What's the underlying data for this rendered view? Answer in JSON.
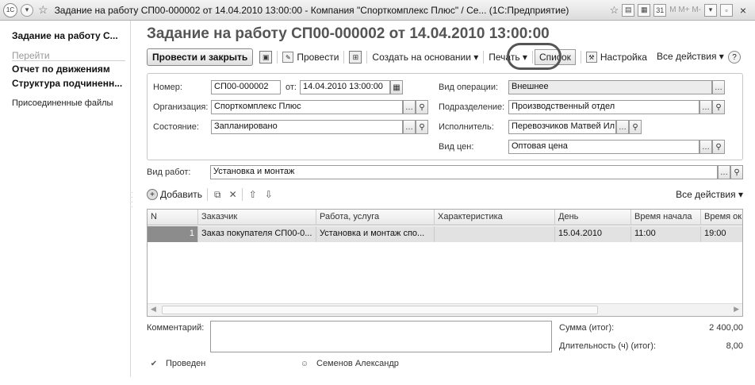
{
  "window": {
    "app_icon": "1С",
    "title": "Задание на работу СП00-000002 от 14.04.2010 13:00:00 - Компания \"Спорткомплекс Плюс\" / Се... (1С:Предприятие)",
    "memory_label": "M M+ M-",
    "close_glyph": "×"
  },
  "left_panel": {
    "active_item": "Задание на работу С...",
    "section_title": "Перейти",
    "links": [
      "Отчет по движениям",
      "Структура подчиненн..."
    ],
    "attached_files": "Присоединенные файлы"
  },
  "document": {
    "title": "Задание на работу СП00-000002 от 14.04.2010 13:00:00"
  },
  "toolbar": {
    "post_close": "Провести и закрыть",
    "post": "Провести",
    "create_based": "Создать на основании ▾",
    "print": "Печать ▾",
    "list": "Список",
    "settings": "Настройка",
    "all_actions": "Все действия ▾",
    "help": "?"
  },
  "header": {
    "number_label": "Номер:",
    "number_value": "СП00-000002",
    "date_label": "от:",
    "date_value": "14.04.2010 13:00:00",
    "org_label": "Организация:",
    "org_value": "Спорткомплекс Плюс",
    "state_label": "Состояние:",
    "state_value": "Запланировано",
    "op_label": "Вид операции:",
    "op_value": "Внешнее",
    "dept_label": "Подразделение:",
    "dept_value": "Производственный отдел",
    "exec_label": "Исполнитель:",
    "exec_value": "Перевозчиков Матвей Ил",
    "price_label": "Вид цен:",
    "price_value": "Оптовая цена"
  },
  "work_type": {
    "label": "Вид работ:",
    "value": "Установка и монтаж"
  },
  "table_toolbar": {
    "add": "Добавить",
    "all_actions": "Все действия ▾"
  },
  "table": {
    "columns": [
      "N",
      "Заказчик",
      "Работа, услуга",
      "Характеристика",
      "День",
      "Время начала",
      "Время ок"
    ],
    "rows": [
      [
        "1",
        "Заказ покупателя СП00-0...",
        "Установка и монтаж спо...",
        "",
        "15.04.2010",
        "11:00",
        "19:00"
      ]
    ]
  },
  "footer": {
    "comment_label": "Комментарий:",
    "sum_label": "Сумма (итог):",
    "sum_value": "2 400,00",
    "duration_label": "Длительность (ч) (итог):",
    "duration_value": "8,00",
    "status": "Проведен",
    "author": "Семенов Александр"
  },
  "colors": {
    "title_text": "#555555",
    "selected_row": "#e2e2e2",
    "row_number_bg": "#8c8c8c"
  }
}
